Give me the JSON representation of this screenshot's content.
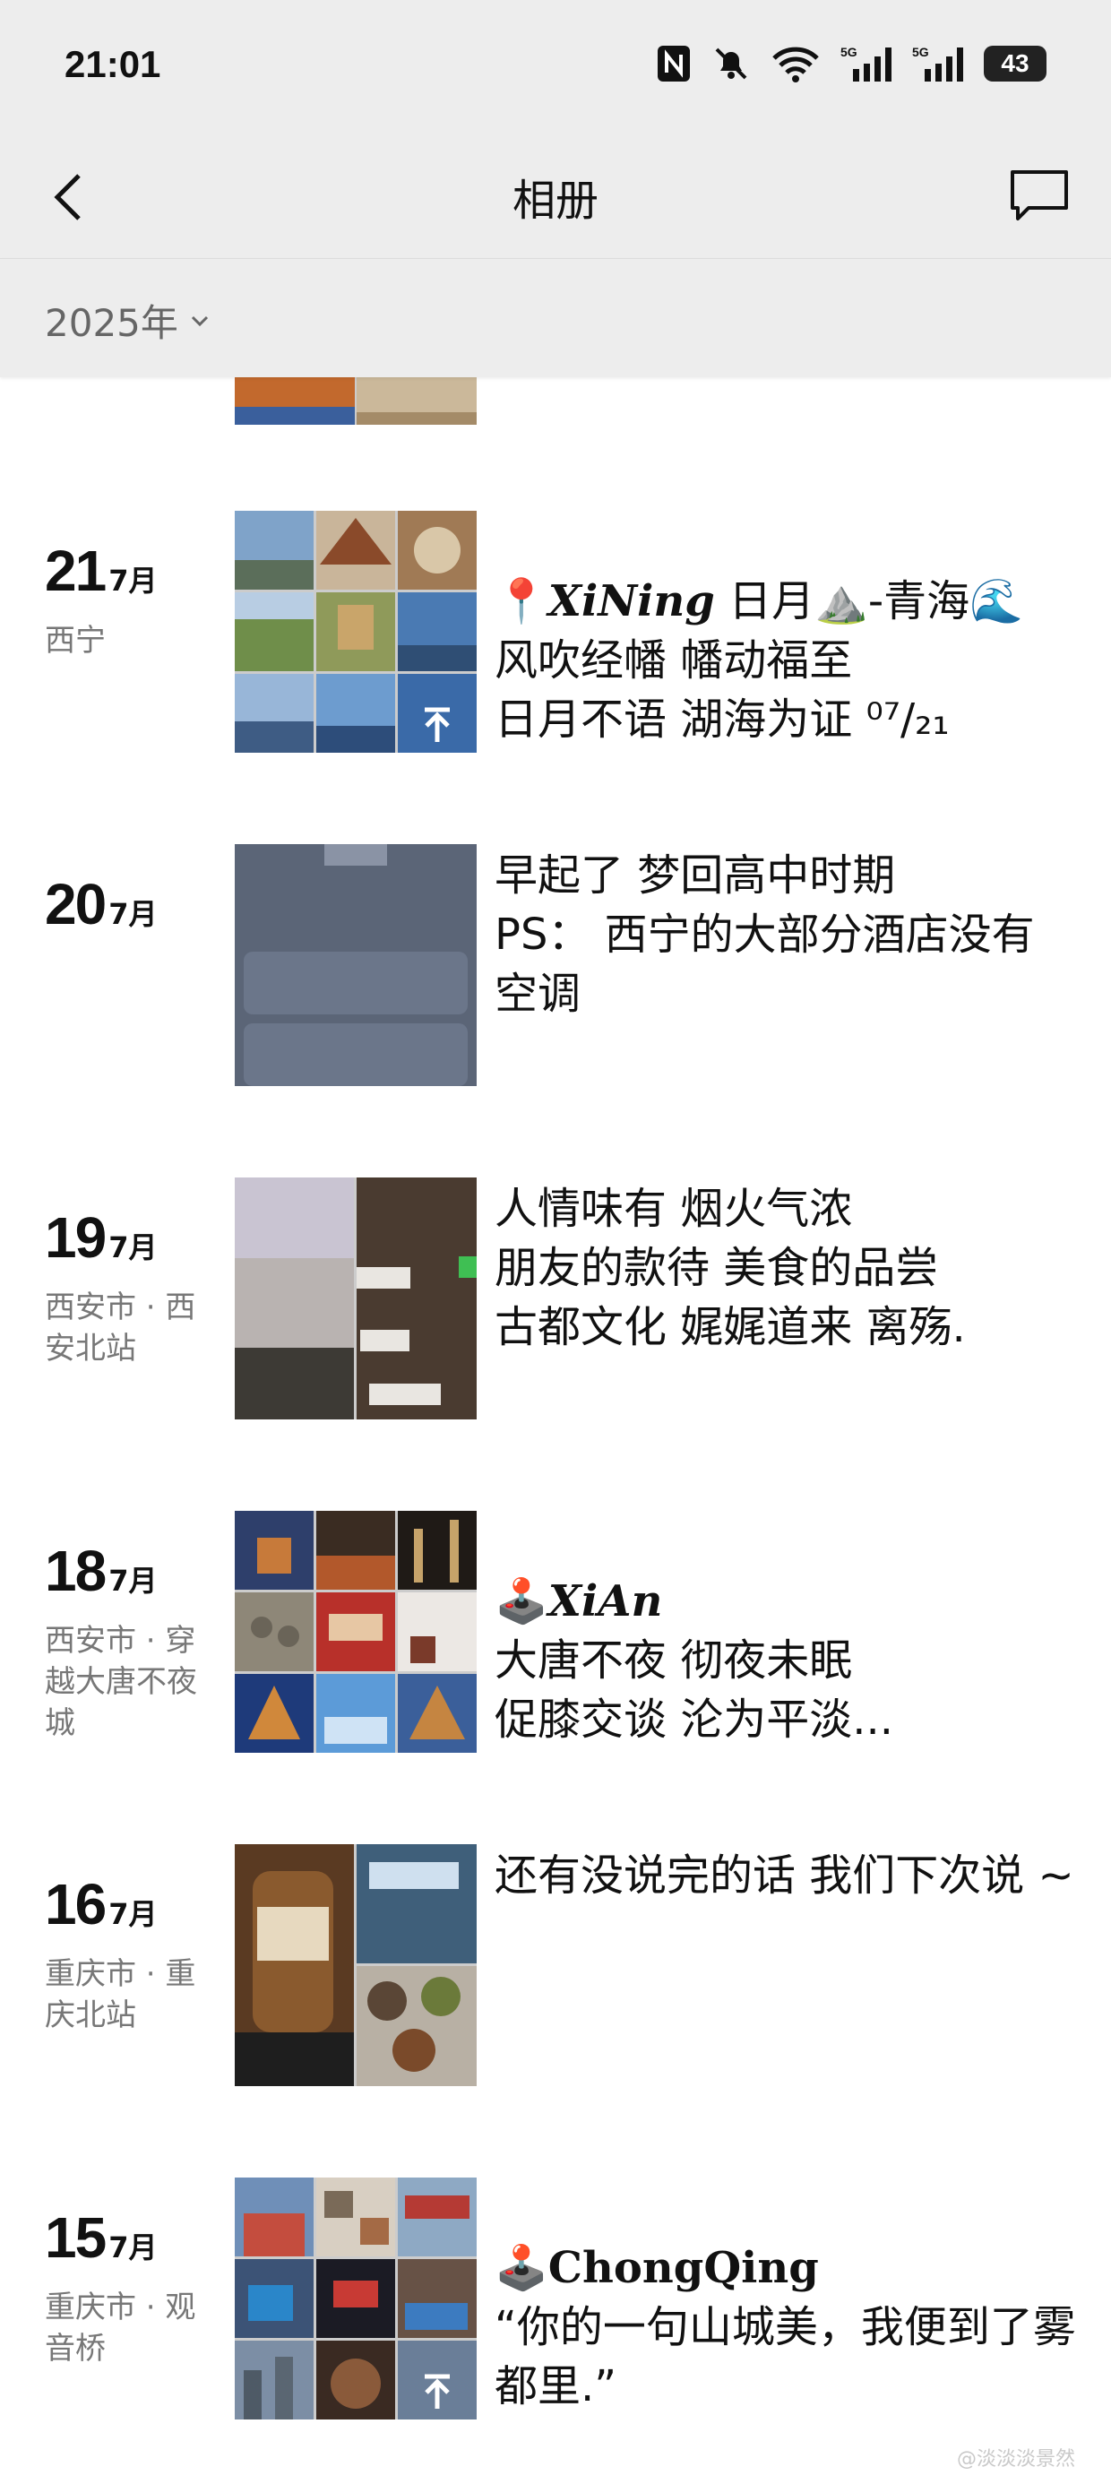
{
  "status_bar": {
    "time": "21:01",
    "battery": "43"
  },
  "nav": {
    "title": "相册"
  },
  "year_filter": {
    "label": "2025年"
  },
  "entries": [
    {
      "day": "21",
      "month": "7月",
      "location": "西宁",
      "caption_loc": "XiNing",
      "caption_head_rest": " 日月⛰️-青海🌊",
      "caption_body": "风吹经幡 幡动福至\n日月不语 湖海为证   ⁰⁷/₂₁"
    },
    {
      "day": "20",
      "month": "7月",
      "location": "",
      "caption_body": "早起了 梦回高中时期\nPS： 西宁的大部分酒店没有空调"
    },
    {
      "day": "19",
      "month": "7月",
      "location": "西安市 · 西安北站",
      "caption_body": "人情味有 烟火气浓\n朋友的款待 美食的品尝\n古都文化 娓娓道来  离殇."
    },
    {
      "day": "18",
      "month": "7月",
      "location": "西安市 · 穿越大唐不夜城",
      "caption_loc": "XiAn",
      "caption_body": "大唐不夜 彻夜未眠\n促膝交谈 沦为平淡..."
    },
    {
      "day": "16",
      "month": "7月",
      "location": "重庆市 · 重庆北站",
      "caption_body": "还有没说完的话 我们下次说 ~"
    },
    {
      "day": "15",
      "month": "7月",
      "location": "重庆市 · 观音桥",
      "caption_loc": "ChongQing",
      "caption_body": "“你的一句山城美，我便到了雾都里.”"
    }
  ],
  "watermark": "@淡淡淡景然"
}
